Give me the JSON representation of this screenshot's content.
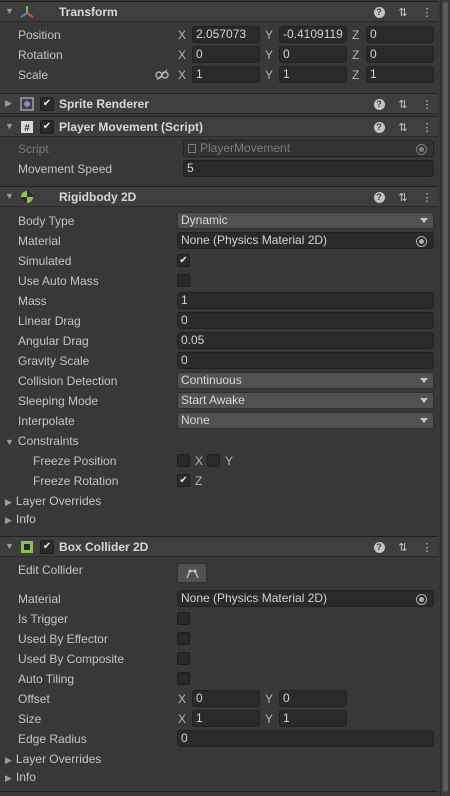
{
  "transform": {
    "title": "Transform",
    "position": {
      "label": "Position",
      "x": "2.057073",
      "y": "-0.4109119",
      "z": "0"
    },
    "rotation": {
      "label": "Rotation",
      "x": "0",
      "y": "0",
      "z": "0"
    },
    "scale": {
      "label": "Scale",
      "x": "1",
      "y": "1",
      "z": "1"
    },
    "axes": {
      "x": "X",
      "y": "Y",
      "z": "Z"
    }
  },
  "sprite_renderer": {
    "title": "Sprite Renderer"
  },
  "player_movement": {
    "title": "Player Movement (Script)",
    "script_label": "Script",
    "script_value": "PlayerMovement",
    "speed_label": "Movement Speed",
    "speed_value": "5"
  },
  "rigidbody": {
    "title": "Rigidbody 2D",
    "body_type": {
      "label": "Body Type",
      "value": "Dynamic"
    },
    "material": {
      "label": "Material",
      "value": "None (Physics Material 2D)"
    },
    "simulated": {
      "label": "Simulated"
    },
    "use_auto_mass": {
      "label": "Use Auto Mass"
    },
    "mass": {
      "label": "Mass",
      "value": "1"
    },
    "linear_drag": {
      "label": "Linear Drag",
      "value": "0"
    },
    "angular_drag": {
      "label": "Angular Drag",
      "value": "0.05"
    },
    "gravity_scale": {
      "label": "Gravity Scale",
      "value": "0"
    },
    "collision_detection": {
      "label": "Collision Detection",
      "value": "Continuous"
    },
    "sleeping_mode": {
      "label": "Sleeping Mode",
      "value": "Start Awake"
    },
    "interpolate": {
      "label": "Interpolate",
      "value": "None"
    },
    "constraints": {
      "label": "Constraints",
      "freeze_position": {
        "label": "Freeze Position",
        "x": "X",
        "y": "Y"
      },
      "freeze_rotation": {
        "label": "Freeze Rotation",
        "z": "Z"
      }
    },
    "layer_overrides": "Layer Overrides",
    "info": "Info"
  },
  "box_collider": {
    "title": "Box Collider 2D",
    "edit_collider": {
      "label": "Edit Collider"
    },
    "material": {
      "label": "Material",
      "value": "None (Physics Material 2D)"
    },
    "is_trigger": {
      "label": "Is Trigger"
    },
    "used_by_effector": {
      "label": "Used By Effector"
    },
    "used_by_composite": {
      "label": "Used By Composite"
    },
    "auto_tiling": {
      "label": "Auto Tiling"
    },
    "offset": {
      "label": "Offset",
      "x": "0",
      "y": "0"
    },
    "size": {
      "label": "Size",
      "x": "1",
      "y": "1"
    },
    "edge_radius": {
      "label": "Edge Radius",
      "value": "0"
    },
    "layer_overrides": "Layer Overrides",
    "info": "Info"
  },
  "colors": {
    "panel": "#383838",
    "header": "#3e3e3e",
    "field": "#2a2a2a",
    "dropdown": "#515151",
    "text": "#c4c4c4"
  }
}
